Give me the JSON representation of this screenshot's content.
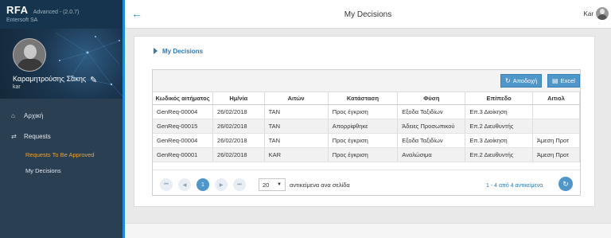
{
  "app": {
    "name": "RFA",
    "version": "Advanced - (2.0.7)",
    "company": "Entersoft SA"
  },
  "profile": {
    "full_name": "Καραμητρούσης Σάκης",
    "short_name": "kar"
  },
  "menu": {
    "home": "Αρχική",
    "requests": "Requests",
    "sub_items": [
      "Requests To Be Approved",
      "My Decisions"
    ]
  },
  "header": {
    "title": "My Decisions",
    "user": "Kar"
  },
  "card": {
    "title": "My Decisions"
  },
  "toolbar": {
    "approve_label": "Αποδοχή",
    "excel_label": "Excel"
  },
  "table": {
    "columns": [
      "Κωδικός αιτήματος",
      "Ημ/νία",
      "Αιτών",
      "Κατάσταση",
      "Φύση",
      "Επίπεδο",
      "Αιτιολ"
    ],
    "rows": [
      [
        "GenReq-00004",
        "26/02/2018",
        "TAN",
        "Προς έγκριση",
        "Εξοδα Ταξιδίων",
        "Επ.3 Διοίκηση",
        ""
      ],
      [
        "GenReq-00015",
        "26/02/2018",
        "TAN",
        "Απορρίφθηκε",
        "Άδειες Προσωπικού",
        "Επ.2 Διευθυντής",
        ""
      ],
      [
        "GenReq-00004",
        "26/02/2018",
        "TAN",
        "Προς έγκριση",
        "Εξοδα Ταξιδίων",
        "Επ.3 Διοίκηση",
        "Άμεση Προτ"
      ],
      [
        "GenReq-00001",
        "26/02/2018",
        "KAR",
        "Προς έγκριση",
        "Αναλώσιμα",
        "Επ.2 Διευθυντής",
        "Άμεση Προτ"
      ]
    ]
  },
  "pager": {
    "current_page": "1",
    "page_size": "20",
    "per_page_label": "αντικείμενα ανα σελίδα",
    "info": "1 - 4 από 4 αντικείμενα",
    "first": "⏮",
    "prev": "◀",
    "next": "▶",
    "last": "⏭"
  },
  "colors": {
    "accent": "#4f96c9",
    "sidebar": "#2b3f52",
    "active_menu": "#e8a33a"
  },
  "icons": {
    "home": "home-icon",
    "requests": "exchange-icon",
    "back": "arrow-left-icon",
    "edit": "pencil-icon",
    "refresh": "refresh-icon"
  }
}
